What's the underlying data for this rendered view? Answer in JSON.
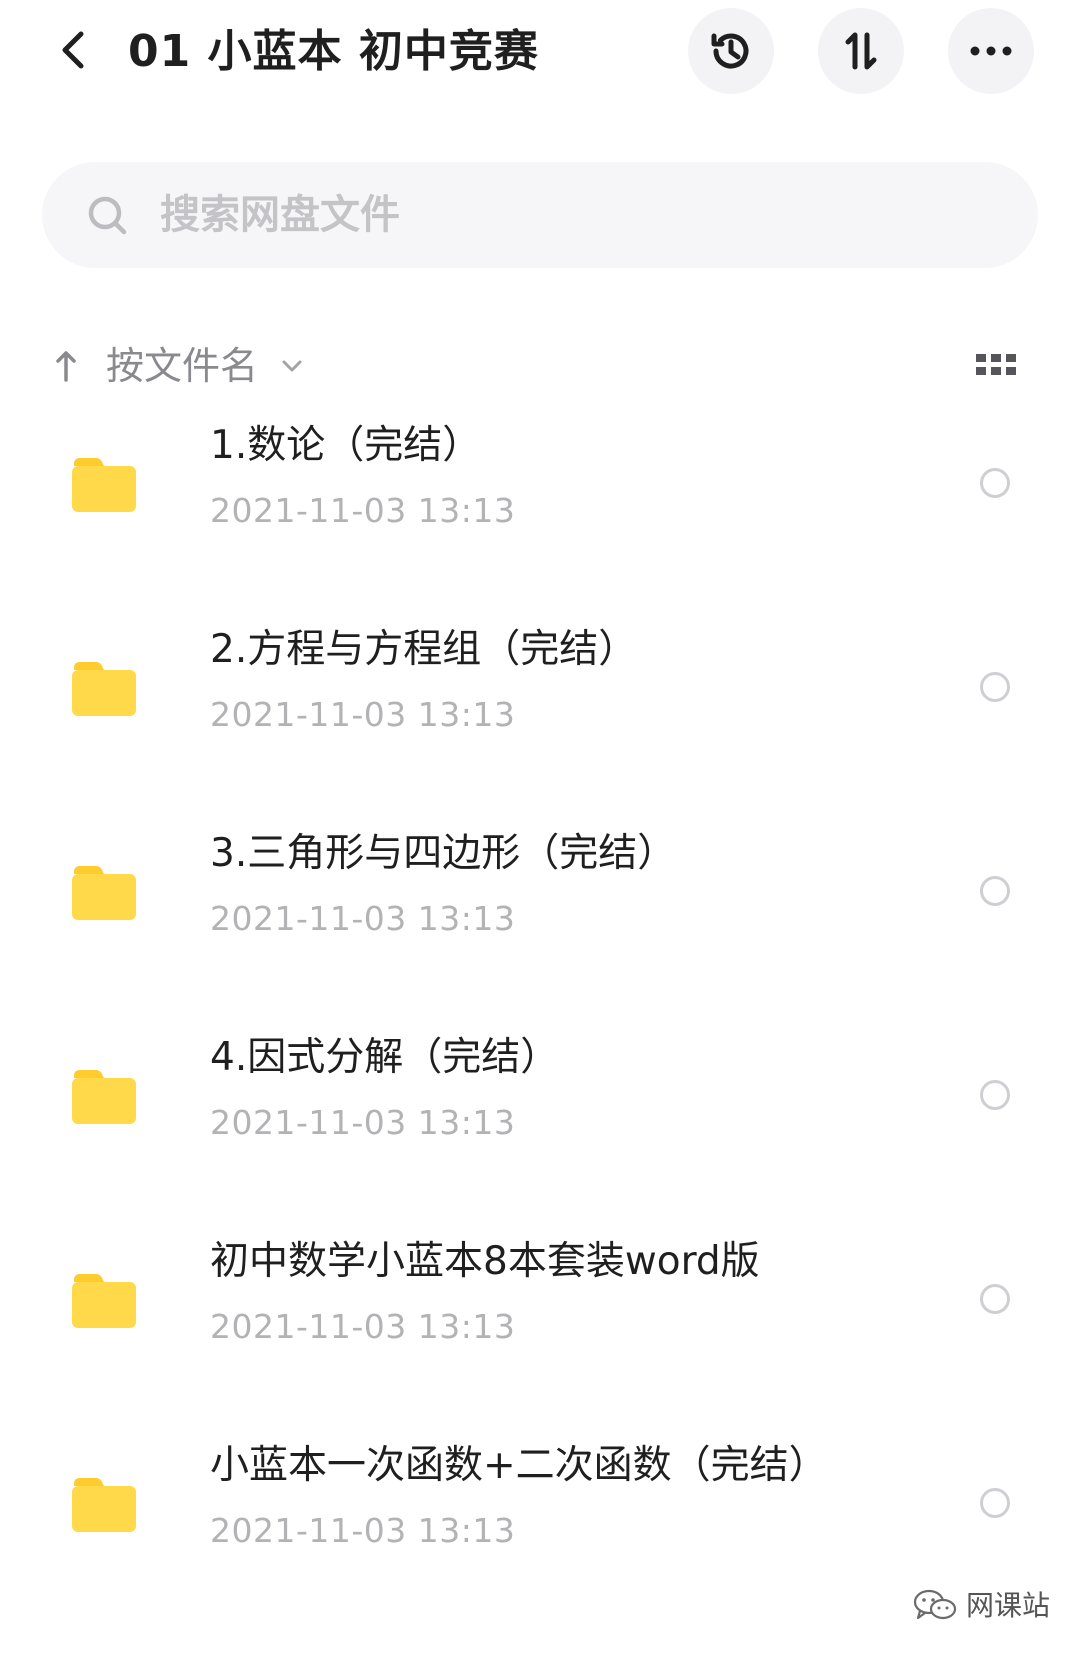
{
  "header": {
    "title": "01 小蓝本 初中竞赛",
    "back_icon": "chevron-left-icon",
    "actions": [
      {
        "name": "history",
        "icon": "history-icon"
      },
      {
        "name": "sort",
        "icon": "sort-arrows-icon"
      },
      {
        "name": "more",
        "icon": "more-dots-icon"
      }
    ]
  },
  "search": {
    "placeholder": "搜索网盘文件",
    "icon": "search-icon"
  },
  "sort": {
    "label": "按文件名",
    "direction_icon": "arrow-up-icon",
    "dropdown_icon": "chevron-down-icon",
    "view_icon": "grid-view-icon"
  },
  "files": [
    {
      "name": "1.数论（完结）",
      "date": "2021-11-03  13:13",
      "type": "folder"
    },
    {
      "name": "2.方程与方程组（完结）",
      "date": "2021-11-03  13:13",
      "type": "folder"
    },
    {
      "name": "3.三角形与四边形（完结）",
      "date": "2021-11-03  13:13",
      "type": "folder"
    },
    {
      "name": "4.因式分解（完结）",
      "date": "2021-11-03  13:13",
      "type": "folder"
    },
    {
      "name": "初中数学小蓝本8本套装word版",
      "date": "2021-11-03  13:13",
      "type": "folder"
    },
    {
      "name": "小蓝本一次函数+二次函数（完结）",
      "date": "2021-11-03  13:13",
      "type": "folder"
    }
  ],
  "watermark": {
    "text": "网课站",
    "icon": "wechat-icon"
  },
  "colors": {
    "folder": "#ffd94a",
    "folder_tab": "#ffcc2e",
    "text_primary": "#1f1f1f",
    "text_secondary": "#b3b3b6",
    "button_bg": "#f3f3f5"
  }
}
